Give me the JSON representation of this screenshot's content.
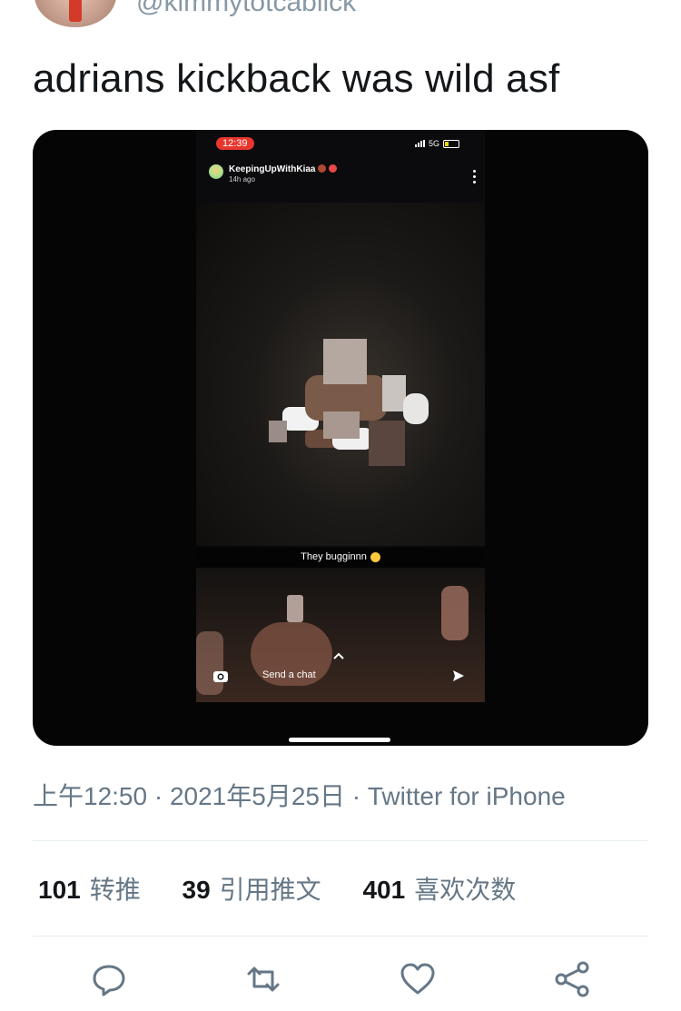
{
  "tweet": {
    "handle": "@kimmytotcablick",
    "text": "adrians kickback was wild asf",
    "meta": "上午12:50 · 2021年5月25日 · Twitter for iPhone"
  },
  "media": {
    "status_time": "12:39",
    "network": "5G",
    "story_user": "KeepingUpWithKiaa",
    "story_time": "14h ago",
    "caption": "They bugginnn",
    "chat_placeholder": "Send a chat"
  },
  "stats": {
    "retweets_count": "101",
    "retweets_label": "转推",
    "quotes_count": "39",
    "quotes_label": "引用推文",
    "likes_count": "401",
    "likes_label": "喜欢次数"
  },
  "actions": {
    "icons": [
      "reply-icon",
      "retweet-icon",
      "like-icon",
      "share-icon"
    ]
  },
  "colors": {
    "text": "#14171a",
    "secondary": "#657786",
    "divider": "#e6ecf0",
    "status_red": "#e8362d"
  }
}
